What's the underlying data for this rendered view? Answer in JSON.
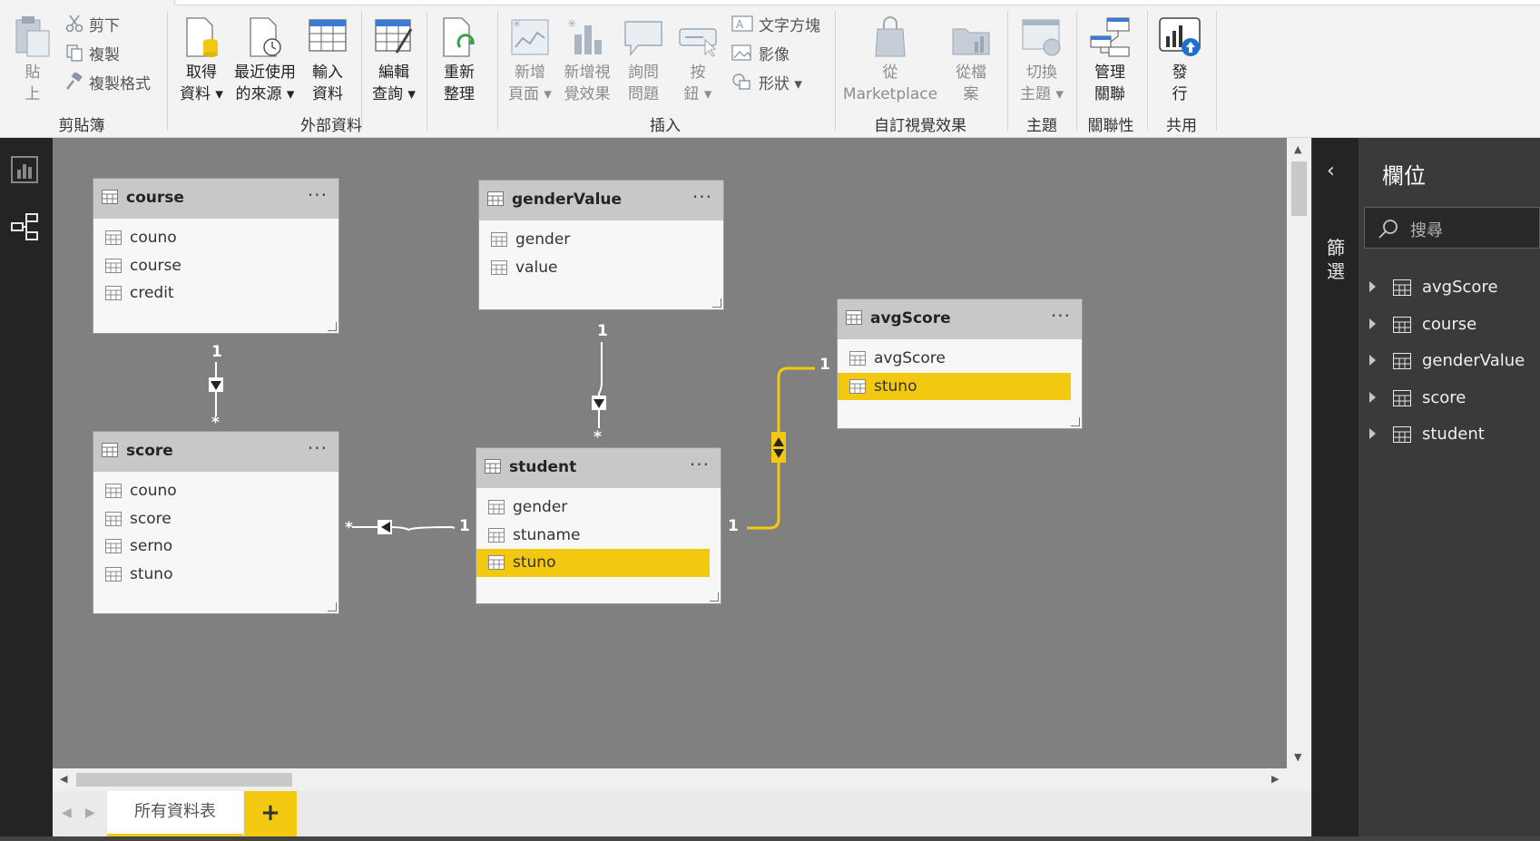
{
  "ribbon": {
    "clipboard": {
      "paste": [
        "貼",
        "上"
      ],
      "cut": "剪下",
      "copy": "複製",
      "format_painter": "複製格式",
      "group": "剪貼簿"
    },
    "external": {
      "get_data": [
        "取得",
        "資料 ▾"
      ],
      "recent_sources": [
        "最近使用",
        "的來源 ▾"
      ],
      "enter_data": [
        "輸入",
        "資料"
      ],
      "edit_queries": [
        "編輯",
        "查詢 ▾"
      ],
      "refresh": [
        "重新",
        "整理"
      ],
      "group": "外部資料"
    },
    "insert": {
      "new_page": [
        "新增",
        "頁面 ▾"
      ],
      "new_visual": [
        "新增視",
        "覺效果"
      ],
      "ask_question": [
        "詢問",
        "問題"
      ],
      "buttons": [
        "按",
        "鈕 ▾"
      ],
      "textbox": "文字方塊",
      "image": "影像",
      "shapes": "形狀 ▾",
      "group": "插入"
    },
    "custom_visuals": {
      "from_marketplace": [
        "從",
        "Marketplace"
      ],
      "from_file": [
        "從檔",
        "案"
      ],
      "group": "自訂視覺效果"
    },
    "themes": {
      "switch_theme": [
        "切換",
        "主題 ▾"
      ],
      "group": "主題"
    },
    "relationships": {
      "manage": [
        "管理",
        "關聯"
      ],
      "group": "關聯性"
    },
    "share": {
      "publish": [
        "發",
        "行"
      ],
      "group": "共用"
    }
  },
  "tables": {
    "course": {
      "name": "course",
      "more": "···",
      "fields": [
        "couno",
        "course",
        "credit"
      ]
    },
    "genderValue": {
      "name": "genderValue",
      "more": "···",
      "fields": [
        "gender",
        "value"
      ]
    },
    "avgScore": {
      "name": "avgScore",
      "more": "···",
      "fields": [
        "avgScore",
        "stuno"
      ]
    },
    "score": {
      "name": "score",
      "more": "···",
      "fields": [
        "couno",
        "score",
        "serno",
        "stuno"
      ]
    },
    "student": {
      "name": "student",
      "more": "···",
      "fields": [
        "gender",
        "stuname",
        "stuno"
      ]
    }
  },
  "relations": {
    "course_score": {
      "one": "1",
      "many": "*"
    },
    "gender_student": {
      "one": "1",
      "many": "*"
    },
    "student_score": {
      "one": "1",
      "many": "*"
    },
    "student_avg": {
      "one_left": "1",
      "one_right": "1"
    }
  },
  "tabs": {
    "all_tables": "所有資料表",
    "add": "+"
  },
  "pane": {
    "collapse_label": "篩選",
    "title": "欄位",
    "search_placeholder": "搜尋",
    "items": [
      "avgScore",
      "course",
      "genderValue",
      "score",
      "student"
    ]
  },
  "colors": {
    "accent": "#f2c811",
    "canvas": "#808080",
    "dark": "#252423"
  }
}
